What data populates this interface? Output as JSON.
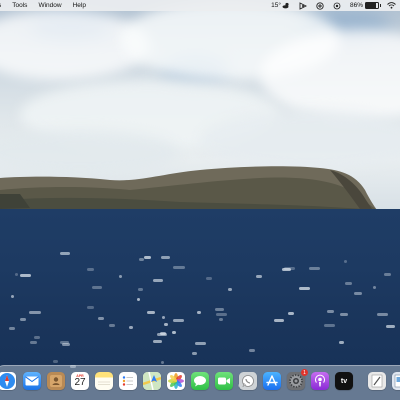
{
  "menubar": {
    "items": [
      "Tools",
      "Window",
      "Help"
    ],
    "weather": "15°",
    "battery_percent": "86%",
    "battery_level": 0.86
  },
  "dock": {
    "calendar": {
      "month": "APR",
      "day": "27"
    },
    "settings_badge": "1",
    "appletv_label": "tv",
    "apps": [
      "Safari",
      "Mail",
      "Contacts",
      "Calendar",
      "Notes",
      "Reminders",
      "Maps",
      "Photos",
      "Messages",
      "FaceTime",
      "WhatsApp",
      "App Store",
      "System Settings",
      "Podcasts",
      "Apple TV",
      "Script Editor",
      "Preview"
    ]
  },
  "colors": {
    "sea": "#1d3a62",
    "menubar": "#eceef0",
    "accent": "#2d7cf6"
  }
}
